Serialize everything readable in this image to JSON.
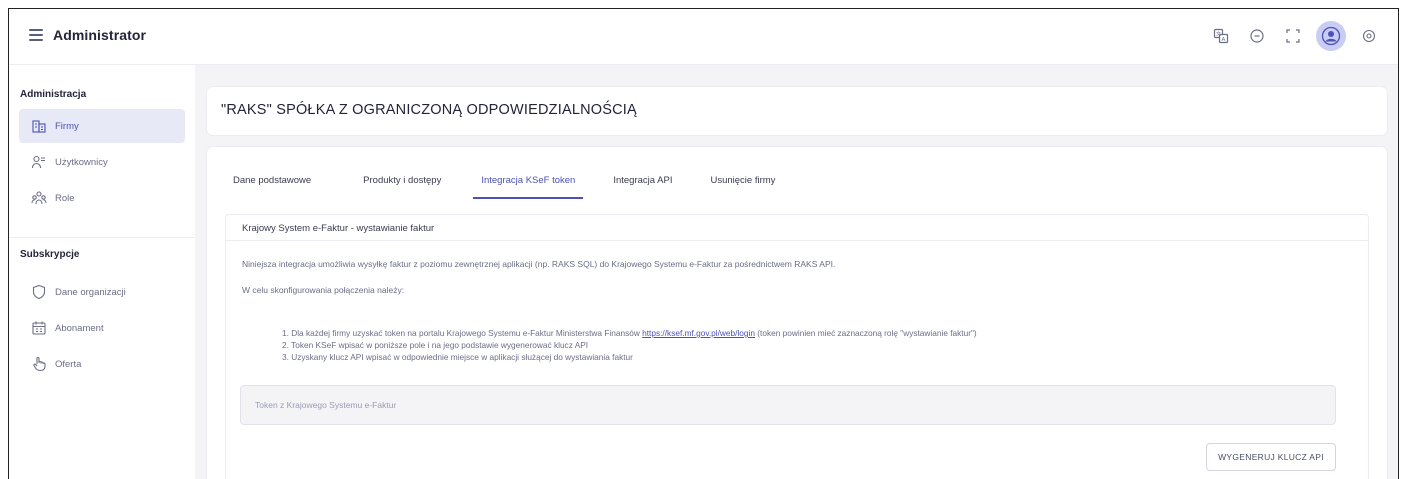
{
  "header": {
    "app_title": "Administrator",
    "icons": [
      "translate-icon",
      "status-icon",
      "fullscreen-icon",
      "user-avatar-icon",
      "settings-icon"
    ]
  },
  "sidebar": {
    "sections": [
      {
        "title": "Administracja",
        "items": [
          {
            "label": "Firmy",
            "icon": "building-icon",
            "active": true
          },
          {
            "label": "Użytkownicy",
            "icon": "users-icon",
            "active": false
          },
          {
            "label": "Role",
            "icon": "roles-icon",
            "active": false
          }
        ]
      },
      {
        "title": "Subskrypcje",
        "items": [
          {
            "label": "Dane organizacji",
            "icon": "shield-icon",
            "active": false
          },
          {
            "label": "Abonament",
            "icon": "calendar-icon",
            "active": false
          },
          {
            "label": "Oferta",
            "icon": "hand-pointer-icon",
            "active": false
          }
        ]
      }
    ]
  },
  "company": {
    "name": "\"RAKS\" SPÓŁKA Z OGRANICZONĄ ODPOWIEDZIALNOŚCIĄ"
  },
  "tabs": [
    {
      "label": "Dane podstawowe",
      "active": false
    },
    {
      "label": "Produkty i dostępy",
      "active": false
    },
    {
      "label": "Integracja KSeF token",
      "active": true
    },
    {
      "label": "Integracja API",
      "active": false
    },
    {
      "label": "Usunięcie firmy",
      "active": false
    }
  ],
  "ksef": {
    "title": "Krajowy System e-Faktur - wystawianie faktur",
    "description": "Niniejsza integracja umożliwia wysyłkę faktur z poziomu zewnętrznej aplikacji (np. RAKS SQL) do Krajowego Systemu e-Faktur za pośrednictwem RAKS API.",
    "setup_intro": "W celu skonfigurowania połączenia należy:",
    "steps": {
      "step1_before": "1. Dla każdej firmy uzyskać token na portalu Krajowego Systemu e-Faktur Ministerstwa Finansów ",
      "step1_link": "https://ksef.mf.gov.pl/web/login",
      "step1_after": " (token powinien mieć zaznaczoną rolę \"wystawianie faktur\")",
      "step2": "2. Token KSeF wpisać w poniższe pole i na jego podstawie wygenerować klucz API",
      "step3": "3. Uzyskany klucz API wpisać w odpowiednie miejsce w aplikacji służącej do wystawiania faktur"
    },
    "token_placeholder": "Token z Krajowego Systemu e-Faktur",
    "token_value": "",
    "generate_button": "WYGENERUJ KLUCZ API"
  },
  "colors": {
    "accent": "#4b52b5",
    "active_bg": "#e7e9f6",
    "main_bg": "#f4f4f7",
    "avatar_bg": "#c9cdf3"
  }
}
